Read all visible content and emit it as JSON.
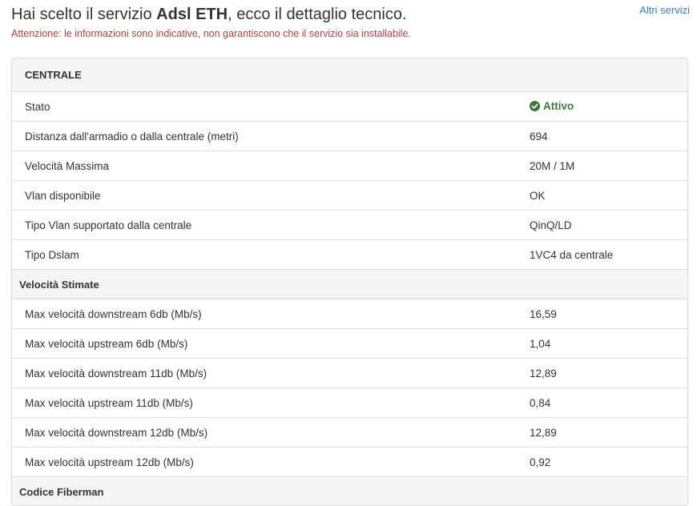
{
  "header": {
    "title_prefix": "Hai scelto il servizio ",
    "title_service": "Adsl ETH",
    "title_suffix": ", ecco il dettaglio tecnico.",
    "warning": "Attenzione: le informazioni sono indicative, non garantiscono che il servizio sia installabile.",
    "other_services_link": "Altri servizi"
  },
  "colors": {
    "link": "#337ab7",
    "warning": "#a94442",
    "success": "#3c763d"
  },
  "panel": {
    "heading": "CENTRALE",
    "rows": [
      {
        "label": "Stato",
        "value": "Attivo",
        "icon": "check-circle-icon"
      },
      {
        "label": "Distanza dall'armadio o dalla centrale (metri)",
        "value": "694"
      },
      {
        "label": "Velocità Massima",
        "value": "20M / 1M"
      },
      {
        "label": "Vlan disponibile",
        "value": "OK"
      },
      {
        "label": "Tipo Vlan supportato dalla centrale",
        "value": "QinQ/LD"
      },
      {
        "label": "Tipo Dslam",
        "value": "1VC4 da centrale"
      }
    ],
    "speed_section": {
      "title": "Velocità Stimate",
      "rows": [
        {
          "label": "Max velocità downstream 6db (Mb/s)",
          "value": "16,59"
        },
        {
          "label": "Max velocità upstream 6db (Mb/s)",
          "value": "1,04"
        },
        {
          "label": "Max velocità downstream 11db (Mb/s)",
          "value": "12,89"
        },
        {
          "label": "Max velocità upstream 11db (Mb/s)",
          "value": "0,84"
        },
        {
          "label": "Max velocità downstream 12db (Mb/s)",
          "value": "12,89"
        },
        {
          "label": "Max velocità upstream 12db (Mb/s)",
          "value": "0,92"
        }
      ]
    },
    "next_section": {
      "title": "Codice Fiberman"
    }
  }
}
